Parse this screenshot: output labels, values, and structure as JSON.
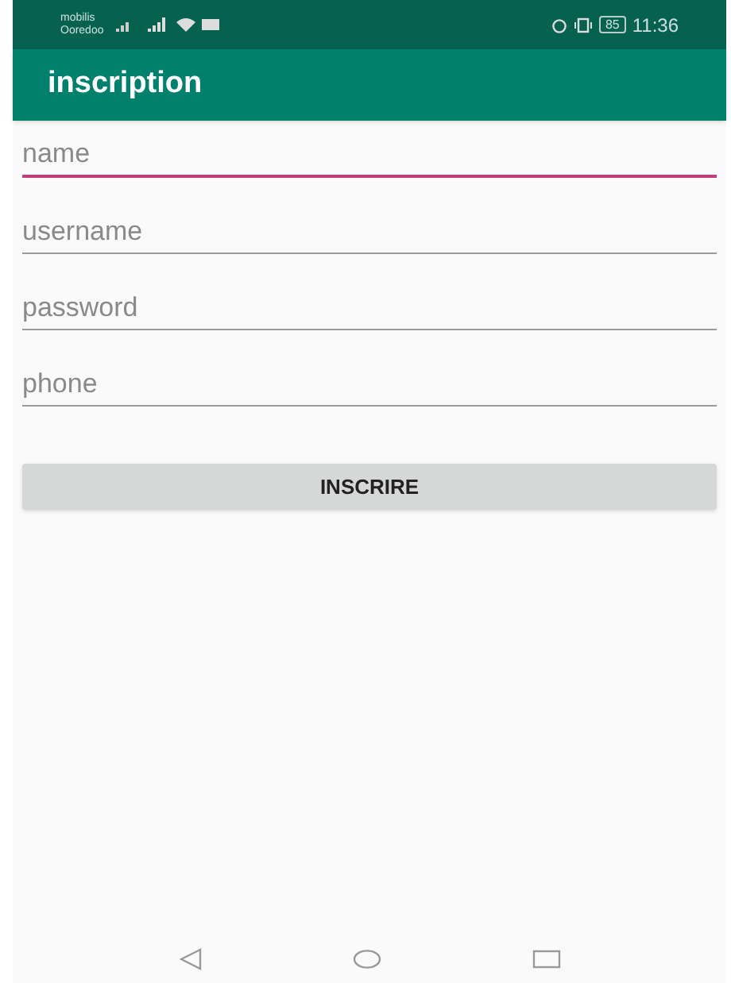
{
  "status_bar": {
    "carrier_1": "mobilis",
    "carrier_2": "Ooredoo",
    "battery": "85",
    "time": "11:36"
  },
  "app_bar": {
    "title": "inscription"
  },
  "fields": [
    {
      "placeholder": "name",
      "focused": true
    },
    {
      "placeholder": "username",
      "focused": false
    },
    {
      "placeholder": "password",
      "focused": false
    },
    {
      "placeholder": "phone",
      "focused": false
    }
  ],
  "button": {
    "label": "INSCRIRE"
  }
}
